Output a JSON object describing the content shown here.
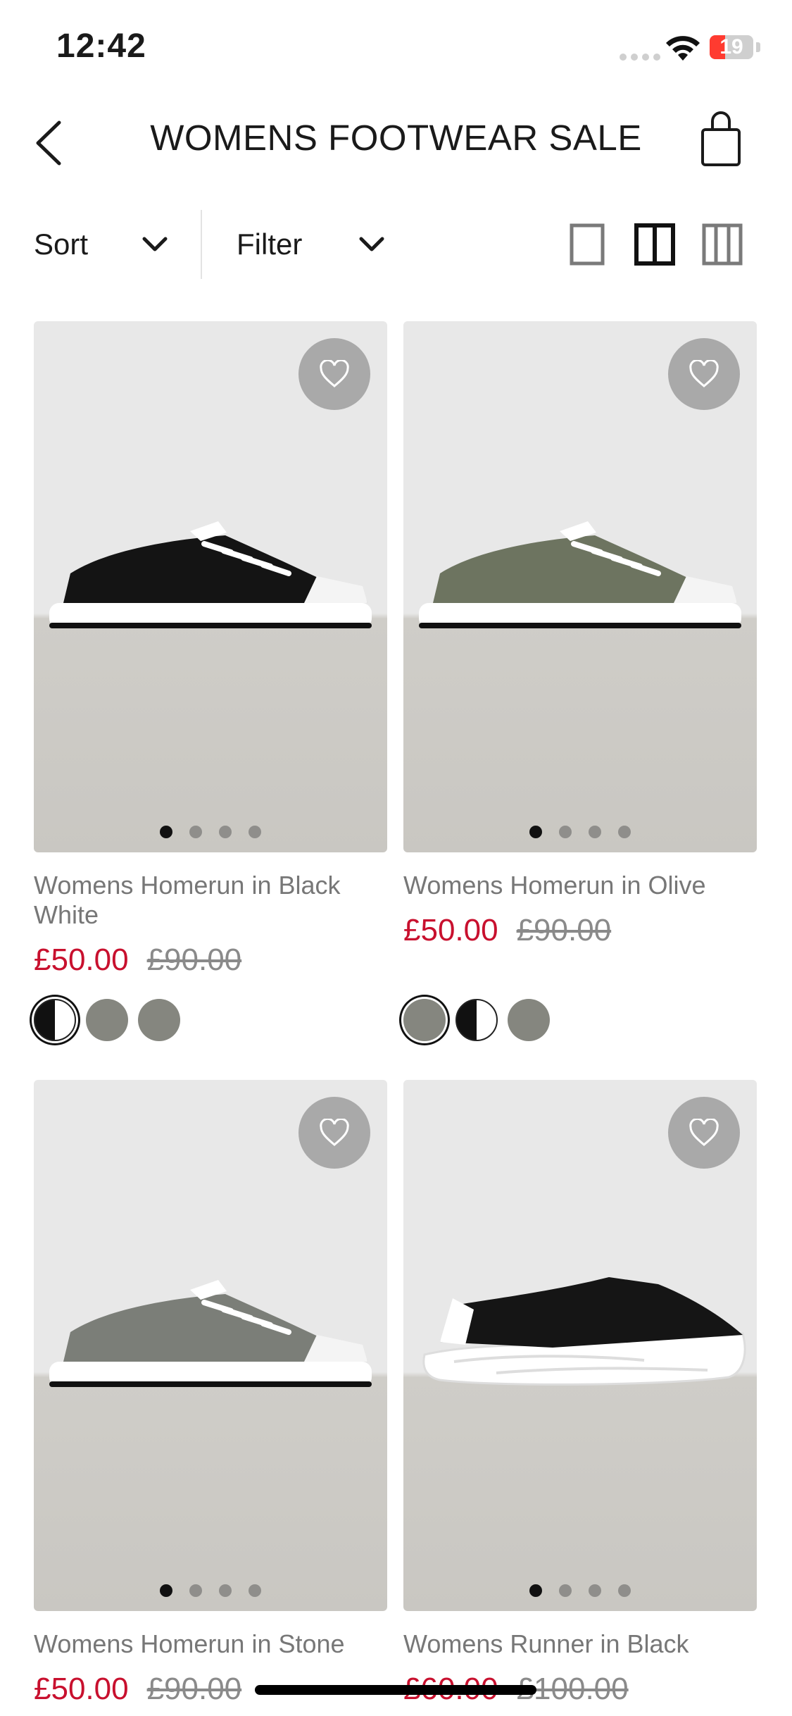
{
  "status_bar": {
    "time": "12:42",
    "battery": "19"
  },
  "header": {
    "title": "WOMENS FOOTWEAR SALE",
    "back_icon": "chevron-left-icon",
    "bag_icon": "shopping-bag-icon"
  },
  "toolbar": {
    "sort_label": "Sort",
    "filter_label": "Filter"
  },
  "products": [
    {
      "name": "Womens Homerun in Black White",
      "sale_price": "£50.00",
      "original_price": "£90.00",
      "shoe_color": "#141414",
      "swatches": [
        "black-white",
        "grey",
        "grey"
      ],
      "image_count": 4
    },
    {
      "name": "Womens Homerun in Olive",
      "sale_price": "£50.00",
      "original_price": "£90.00",
      "shoe_color": "#6d7460",
      "swatches": [
        "grey",
        "black-white",
        "grey"
      ],
      "image_count": 4
    },
    {
      "name": "Womens Homerun in Stone",
      "sale_price": "£50.00",
      "original_price": "£90.00",
      "shoe_color": "#7b7e78",
      "swatches": [],
      "image_count": 4
    },
    {
      "name": "Womens Runner in Black",
      "sale_price": "£60.00",
      "original_price": "£100.00",
      "shoe_color": "#151515",
      "swatches": [],
      "image_count": 4
    }
  ],
  "colors": {
    "sale": "#c8102e",
    "text": "#1a1a1a",
    "muted": "#777777"
  }
}
